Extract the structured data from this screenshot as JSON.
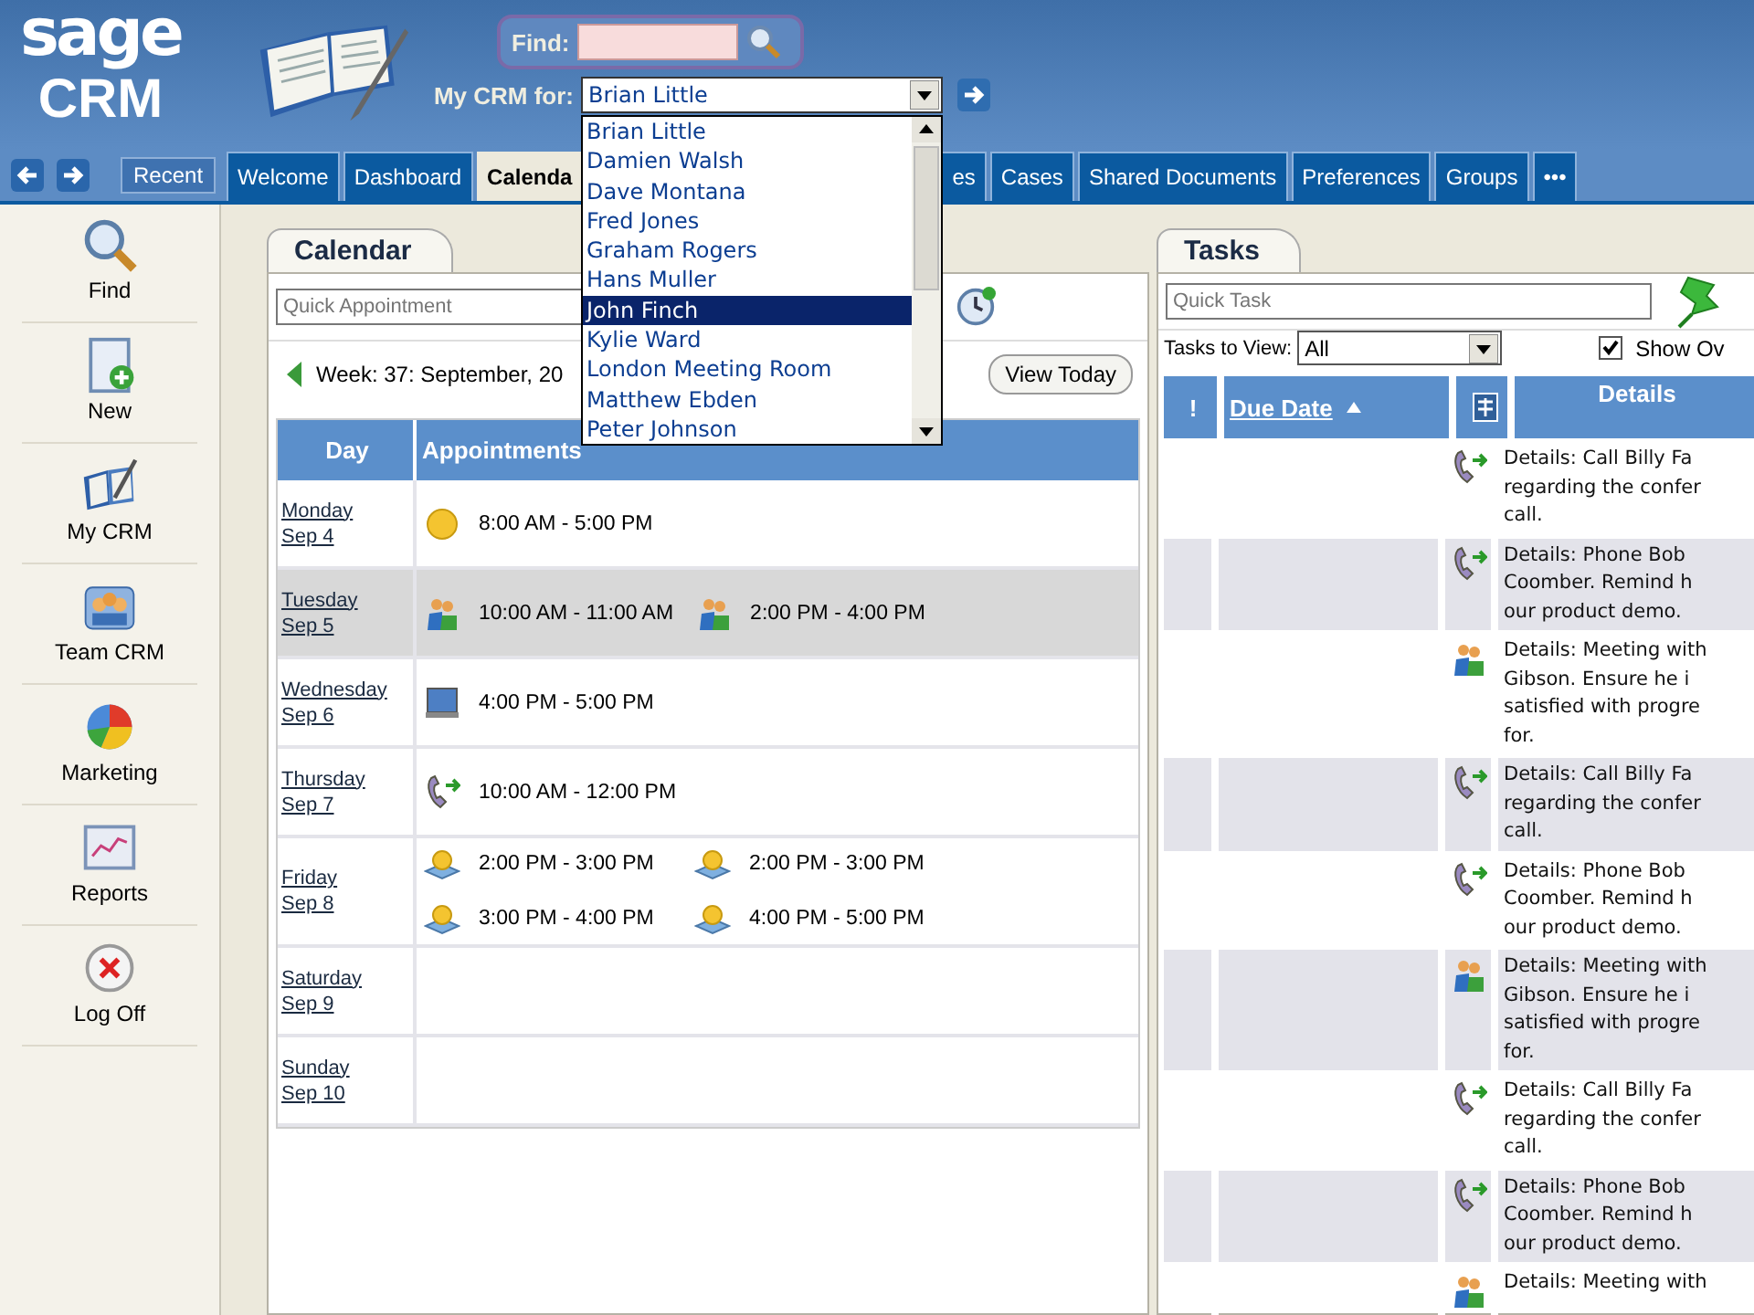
{
  "header": {
    "logo_top": "sage",
    "logo_bottom": "CRM",
    "find_label": "Find:",
    "crm_label": "My CRM for:",
    "crm_value": "Brian Little",
    "crm_options": [
      {
        "label": "Brian Little",
        "selected": false
      },
      {
        "label": "Damien Walsh",
        "selected": false
      },
      {
        "label": "Dave Montana",
        "selected": false
      },
      {
        "label": "Fred Jones",
        "selected": false
      },
      {
        "label": "Graham Rogers",
        "selected": false
      },
      {
        "label": "Hans Muller",
        "selected": false
      },
      {
        "label": "John Finch",
        "selected": true
      },
      {
        "label": "Kylie Ward",
        "selected": false
      },
      {
        "label": "London Meeting Room",
        "selected": false
      },
      {
        "label": "Matthew Ebden",
        "selected": false
      },
      {
        "label": "Peter Johnson",
        "selected": false
      }
    ]
  },
  "nav": {
    "recent": "Recent",
    "tabs": [
      {
        "label": "Welcome",
        "selected": false
      },
      {
        "label": "Dashboard",
        "selected": false
      },
      {
        "label": "Calenda",
        "selected": true
      },
      {
        "label": "es",
        "selected": false
      },
      {
        "label": "Cases",
        "selected": false
      },
      {
        "label": "Shared Documents",
        "selected": false
      },
      {
        "label": "Preferences",
        "selected": false
      },
      {
        "label": "Groups",
        "selected": false
      },
      {
        "label": "•••",
        "selected": false
      }
    ]
  },
  "sidebar": {
    "items": [
      {
        "label": "Find",
        "kind": "find"
      },
      {
        "label": "New",
        "kind": "new"
      },
      {
        "label": "My CRM",
        "kind": "mycrm"
      },
      {
        "label": "Team CRM",
        "kind": "team"
      },
      {
        "label": "Marketing",
        "kind": "marketing"
      },
      {
        "label": "Reports",
        "kind": "reports"
      },
      {
        "label": "Log Off",
        "kind": "logoff"
      }
    ]
  },
  "calendar": {
    "tab": "Calendar",
    "quick_placeholder": "Quick Appointment",
    "week": "Week: 37: September, 20",
    "view_today": "View Today",
    "columns": [
      "Day",
      "Appointments"
    ],
    "rows": [
      {
        "day": "Monday",
        "date": "Sep 4",
        "selected": false,
        "appointments": [
          {
            "kind": "holiday",
            "time": "8:00 AM - 5:00 PM"
          }
        ]
      },
      {
        "day": "Tuesday",
        "date": "Sep 5",
        "selected": true,
        "appointments": [
          {
            "kind": "meeting",
            "time": "10:00 AM - 11:00 AM"
          },
          {
            "kind": "meeting",
            "time": "2:00 PM - 4:00 PM"
          }
        ]
      },
      {
        "day": "Wednesday",
        "date": "Sep 6",
        "selected": false,
        "appointments": [
          {
            "kind": "demo",
            "time": "4:00 PM - 5:00 PM"
          }
        ]
      },
      {
        "day": "Thursday",
        "date": "Sep 7",
        "selected": false,
        "appointments": [
          {
            "kind": "call",
            "time": "10:00 AM - 12:00 PM"
          }
        ]
      },
      {
        "day": "Friday",
        "date": "Sep 8",
        "selected": false,
        "appointments": [
          {
            "kind": "event",
            "time": "2:00 PM - 3:00 PM"
          },
          {
            "kind": "event",
            "time": "2:00 PM - 3:00 PM"
          },
          {
            "kind": "event",
            "time": "3:00 PM - 4:00 PM"
          },
          {
            "kind": "event",
            "time": "4:00 PM - 5:00 PM"
          }
        ]
      },
      {
        "day": "Saturday",
        "date": "Sep 9",
        "selected": false,
        "appointments": []
      },
      {
        "day": "Sunday",
        "date": "Sep 10",
        "selected": false,
        "appointments": []
      }
    ]
  },
  "tasks": {
    "tab": "Tasks",
    "quick_placeholder": "Quick Task",
    "view_label": "Tasks to View:",
    "view_value": "All",
    "show_label": "Show Ov",
    "show_checked": true,
    "columns": {
      "priority": "!",
      "due": "Due Date",
      "details": "Details"
    },
    "rows": [
      {
        "kind": "call",
        "lines": [
          "Details: Call Billy Fa",
          "regarding the confer",
          "call."
        ]
      },
      {
        "kind": "call",
        "lines": [
          "Details: Phone Bob",
          "Coomber. Remind h",
          "our product demo."
        ]
      },
      {
        "kind": "meeting",
        "lines": [
          "Details: Meeting with",
          "Gibson. Ensure he i",
          "satisfied with progre",
          "for."
        ]
      },
      {
        "kind": "call",
        "lines": [
          "Details: Call Billy Fa",
          "regarding the confer",
          "call."
        ]
      },
      {
        "kind": "call",
        "lines": [
          "Details: Phone Bob",
          "Coomber. Remind h",
          "our product demo."
        ]
      },
      {
        "kind": "meeting",
        "lines": [
          "Details: Meeting with",
          "Gibson. Ensure he i",
          "satisfied with progre",
          "for."
        ]
      },
      {
        "kind": "call",
        "lines": [
          "Details: Call Billy Fa",
          "regarding the confer",
          "call."
        ]
      },
      {
        "kind": "call",
        "lines": [
          "Details: Phone Bob",
          "Coomber. Remind h",
          "our product demo."
        ]
      },
      {
        "kind": "meeting",
        "lines": [
          "Details: Meeting with"
        ]
      }
    ]
  }
}
